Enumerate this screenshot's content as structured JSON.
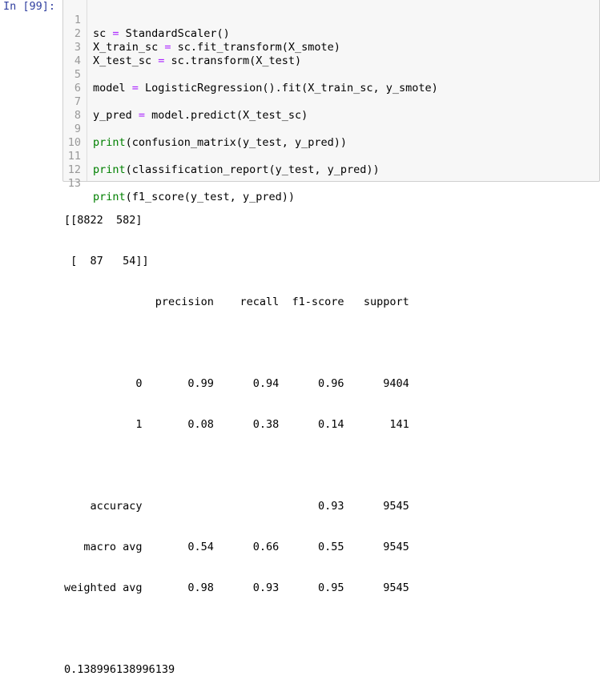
{
  "cell": {
    "prompt": "In [99]:",
    "lines": [
      {
        "n": "1",
        "code": "sc = StandardScaler()"
      },
      {
        "n": "2",
        "code": "X_train_sc = sc.fit_transform(X_smote)"
      },
      {
        "n": "3",
        "code": "X_test_sc = sc.transform(X_test)"
      },
      {
        "n": "4",
        "code": ""
      },
      {
        "n": "5",
        "code": "model = LogisticRegression().fit(X_train_sc, y_smote)"
      },
      {
        "n": "6",
        "code": ""
      },
      {
        "n": "7",
        "code": "y_pred = model.predict(X_test_sc)"
      },
      {
        "n": "8",
        "code": ""
      },
      {
        "n": "9",
        "code": "print(confusion_matrix(y_test, y_pred))"
      },
      {
        "n": "10",
        "code": ""
      },
      {
        "n": "11",
        "code": "print(classification_report(y_test, y_pred))"
      },
      {
        "n": "12",
        "code": ""
      },
      {
        "n": "13",
        "code": "print(f1_score(y_test, y_pred))"
      }
    ]
  },
  "output": {
    "lines": [
      "[[8822  582]",
      " [  87   54]]",
      "              precision    recall  f1-score   support",
      "",
      "           0       0.99      0.94      0.96      9404",
      "           1       0.08      0.38      0.14       141",
      "",
      "    accuracy                           0.93      9545",
      "   macro avg       0.54      0.66      0.55      9545",
      "weighted avg       0.98      0.93      0.95      9545",
      "",
      "0.138996138996139"
    ]
  }
}
